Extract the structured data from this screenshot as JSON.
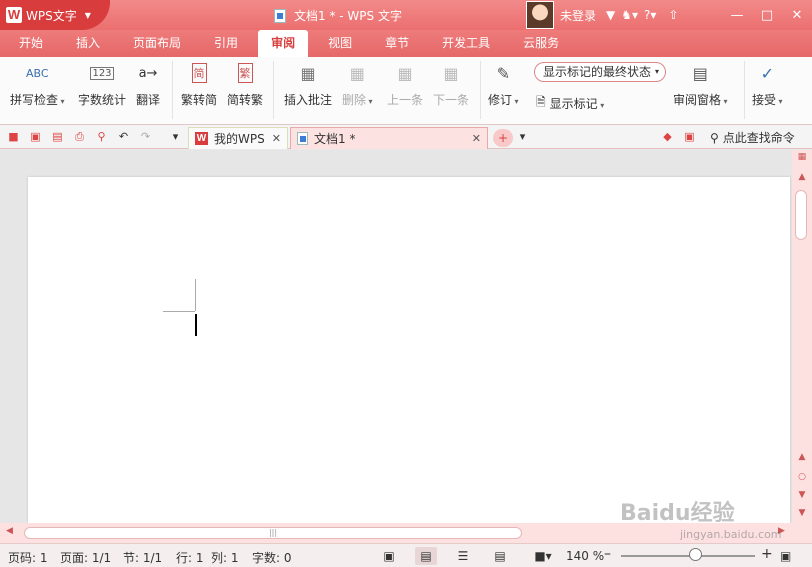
{
  "titlebar": {
    "app_name": "WPS文字",
    "doc_title": "文档1 * - WPS 文字",
    "user_label": "未登录",
    "icons": [
      "shirt-icon",
      "rabbit-icon",
      "help-icon",
      "upload-icon",
      "minimize-icon",
      "maximize-icon",
      "close-icon"
    ],
    "help_label": "?"
  },
  "tabs": [
    {
      "label": "开始"
    },
    {
      "label": "插入"
    },
    {
      "label": "页面布局"
    },
    {
      "label": "引用"
    },
    {
      "label": "审阅",
      "active": true
    },
    {
      "label": "视图"
    },
    {
      "label": "章节"
    },
    {
      "label": "开发工具"
    },
    {
      "label": "云服务"
    }
  ],
  "ribbon": {
    "spell_check": "拼写检查",
    "word_count": "字数统计",
    "translate": "翻译",
    "trad_to_simp": "繁转简",
    "simp_to_trad": "简转繁",
    "insert_comment": "插入批注",
    "delete": "删除",
    "previous": "上一条",
    "next": "下一条",
    "track_changes": "修订",
    "markup_state": "显示标记的最终状态",
    "show_markup": "显示标记",
    "review_pane": "审阅窗格",
    "accept": "接受",
    "icon_text_abc": "ABC",
    "icon_text_123": "123",
    "icon_text_jian": "简",
    "icon_text_fan": "繁"
  },
  "doc_tabs": {
    "home_tab": "我的WPS",
    "doc_tab": "文档1 *",
    "new_tab": "+",
    "find_command": "点此查找命令"
  },
  "status": {
    "page": "页码: 1",
    "pages": "页面: 1/1",
    "section": "节: 1/1",
    "row": "行: 1",
    "col": "列: 1",
    "words": "字数: 0",
    "zoom": "140 %"
  },
  "watermark": {
    "brand": "Baidu经验",
    "url": "jingyan.baidu.com"
  },
  "colors": {
    "accent": "#ec6f6f",
    "accent_dark": "#d83c3c"
  }
}
